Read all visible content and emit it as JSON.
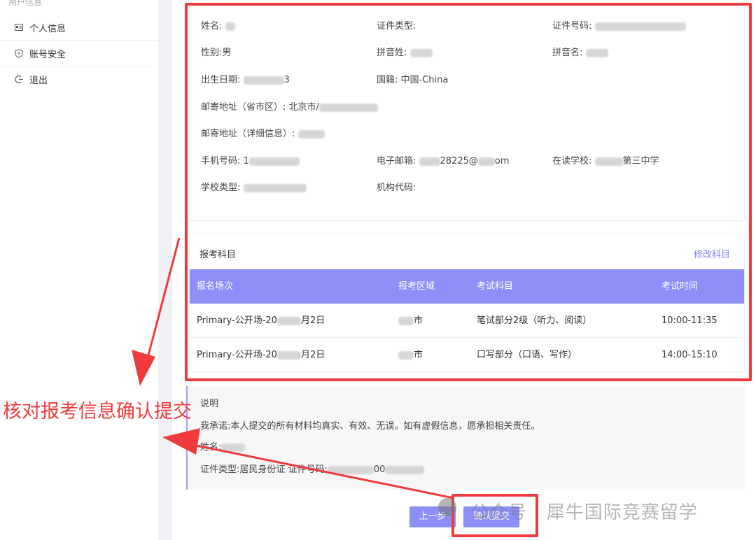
{
  "sidebar": {
    "title": "用户信息",
    "items": [
      {
        "label": "个人信息",
        "icon": "id-card-icon"
      },
      {
        "label": "账号安全",
        "icon": "shield-icon"
      },
      {
        "label": "退出",
        "icon": "logout-icon"
      }
    ]
  },
  "info": {
    "name_label": "姓名:",
    "id_type_label": "证件类型:",
    "id_number_label": "证件号码:",
    "gender_label": "性别:",
    "gender_value": "男",
    "pinyin_surname_label": "拼音姓:",
    "pinyin_given_label": "拼音名:",
    "birth_label": "出生日期:",
    "birth_value_tail": "3",
    "nationality_label": "国籍:",
    "nationality_value": "中国-China",
    "mail_region_label": "邮寄地址（省市区）:",
    "mail_region_value": "北京市/",
    "mail_detail_label": "邮寄地址（详细信息）:",
    "phone_label": "手机号码:",
    "phone_value_head": "1",
    "email_label": "电子邮箱:",
    "email_value_a": "28225@",
    "email_value_b": "om",
    "school_label": "在读学校:",
    "school_value": "第三中学",
    "school_type_label": "学校类型:",
    "org_code_label": "机构代码:"
  },
  "subjects": {
    "title": "报考科目",
    "edit_link": "修改科目",
    "columns": [
      "报名场次",
      "报考区域",
      "考试科目",
      "考试时间"
    ],
    "rows": [
      {
        "session_a": "Primary-公开场-20",
        "session_b": "月2日",
        "region": "市",
        "subject": "笔试部分2级（听力、阅读）",
        "time": "10:00-11:35"
      },
      {
        "session_a": "Primary-公开场-20",
        "session_b": "月2日",
        "region": "市",
        "subject": "口写部分（口语、写作）",
        "time": "14:00-15:10"
      }
    ]
  },
  "note": {
    "title": "说明",
    "pledge": "我承诺:本人提交的所有材料均真实、有效、无误。如有虚假信息，愿承担相关责任。",
    "name_label": "姓名:",
    "id_line": "证件类型:居民身份证  证件号码:",
    "id_tail": "00"
  },
  "buttons": {
    "prev": "上一步",
    "confirm": "确认提交"
  },
  "annotation": {
    "text": "核对报考信息确认提交",
    "color": "#ef3b3b"
  },
  "watermark": {
    "text": "公众号 · 犀牛国际竞赛留学"
  },
  "colors": {
    "accent": "#8b8ff7",
    "annotation": "#ef3b3b"
  }
}
